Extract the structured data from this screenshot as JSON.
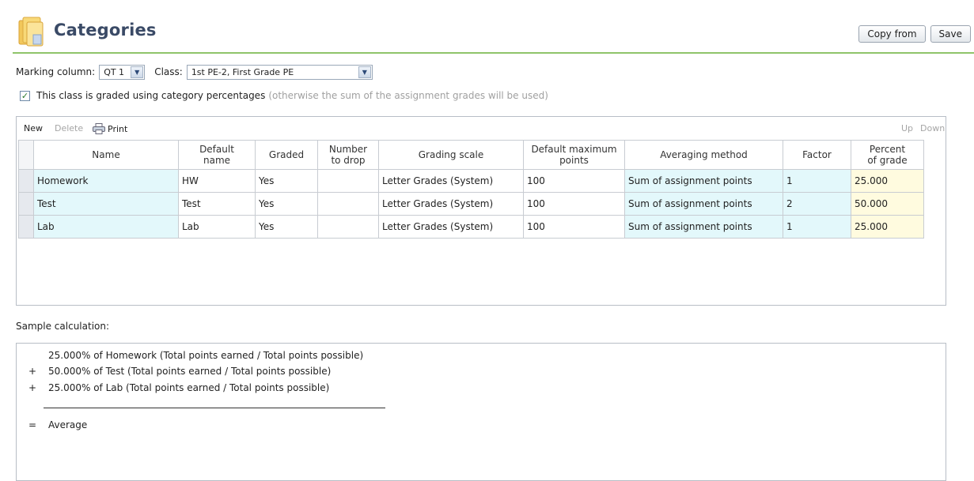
{
  "header": {
    "title": "Categories",
    "buttons": {
      "copy_from": "Copy from",
      "save": "Save"
    }
  },
  "filters": {
    "marking_column_label": "Marking column:",
    "marking_column_value": "QT 1",
    "class_label": "Class:",
    "class_value": "1st PE-2, First Grade PE"
  },
  "graded_option": {
    "checked": true,
    "label": "This class is graded using category percentages",
    "hint": "(otherwise the sum of the assignment grades will be used)"
  },
  "toolbar": {
    "new": "New",
    "delete": "Delete",
    "print": "Print",
    "up": "Up",
    "down": "Down"
  },
  "table": {
    "columns": [
      {
        "line1": "Name",
        "line2": ""
      },
      {
        "line1": "Default",
        "line2": "name"
      },
      {
        "line1": "Graded",
        "line2": ""
      },
      {
        "line1": "Number",
        "line2": "to drop"
      },
      {
        "line1": "Grading scale",
        "line2": ""
      },
      {
        "line1": "Default maximum",
        "line2": "points"
      },
      {
        "line1": "Averaging method",
        "line2": ""
      },
      {
        "line1": "Factor",
        "line2": ""
      },
      {
        "line1": "Percent",
        "line2": "of grade"
      }
    ],
    "rows": [
      {
        "name": "Homework",
        "default_name": "HW",
        "graded": "Yes",
        "drop": "",
        "scale": "Letter Grades (System)",
        "max": "100",
        "method": "Sum of assignment points",
        "factor": "1",
        "percent": "25.000"
      },
      {
        "name": "Test",
        "default_name": "Test",
        "graded": "Yes",
        "drop": "",
        "scale": "Letter Grades (System)",
        "max": "100",
        "method": "Sum of assignment points",
        "factor": "2",
        "percent": "50.000"
      },
      {
        "name": "Lab",
        "default_name": "Lab",
        "graded": "Yes",
        "drop": "",
        "scale": "Letter Grades (System)",
        "max": "100",
        "method": "Sum of assignment points",
        "factor": "1",
        "percent": "25.000"
      }
    ]
  },
  "sample": {
    "label": "Sample calculation:",
    "lines": [
      {
        "op": "",
        "text": "25.000% of Homework (Total points earned / Total points possible)"
      },
      {
        "op": "+",
        "text": "50.000% of Test (Total points earned / Total points possible)"
      },
      {
        "op": "+",
        "text": "25.000% of Lab (Total points earned / Total points possible)"
      }
    ],
    "result": {
      "op": "=",
      "text": "Average"
    }
  }
}
